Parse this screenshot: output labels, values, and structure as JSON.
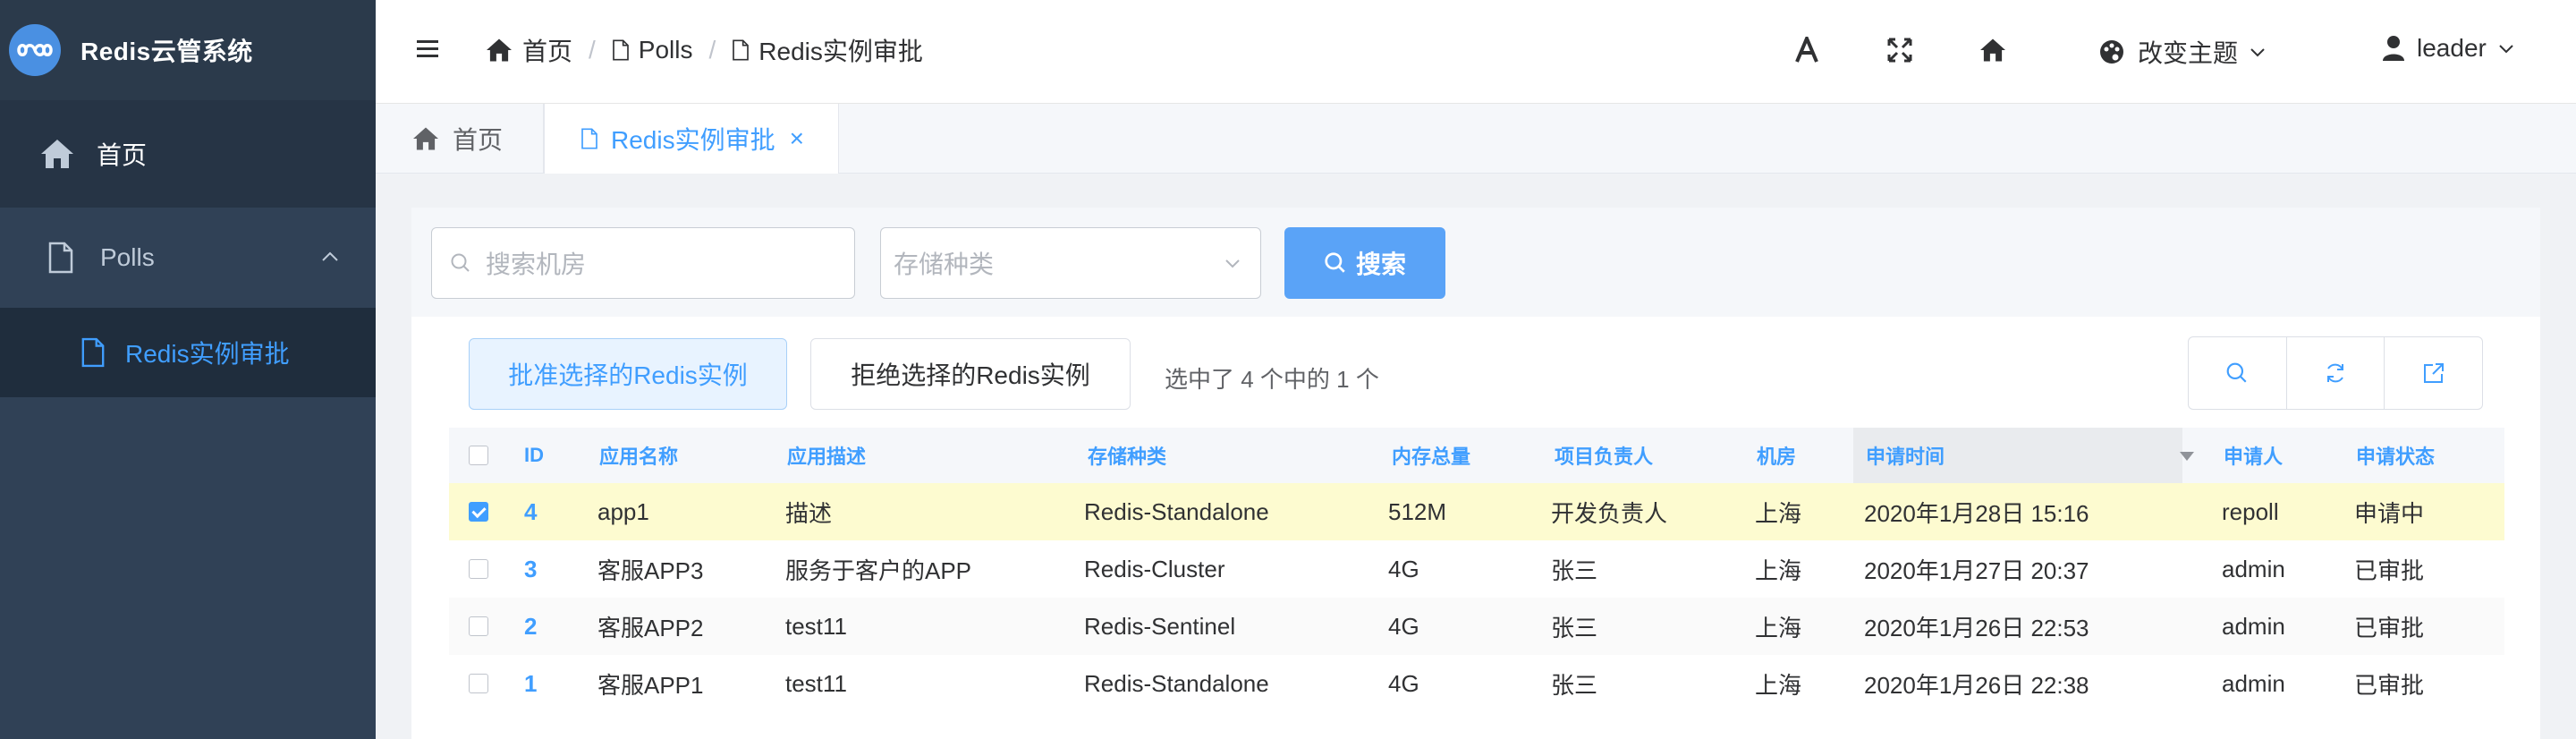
{
  "app": {
    "title": "Redis云管系统"
  },
  "sidebar": {
    "items": [
      {
        "label": "首页"
      },
      {
        "label": "Polls"
      },
      {
        "label": "Redis实例审批"
      }
    ]
  },
  "header": {
    "breadcrumb": [
      "首页",
      "Polls",
      "Redis实例审批"
    ],
    "theme_label": "改变主题",
    "user_label": "leader"
  },
  "tags": [
    {
      "label": "首页"
    },
    {
      "label": "Redis实例审批"
    }
  ],
  "search": {
    "room_placeholder": "搜索机房",
    "type_placeholder": "存储种类",
    "button_label": "搜索"
  },
  "actions": {
    "approve_label": "批准选择的Redis实例",
    "reject_label": "拒绝选择的Redis实例",
    "selection_info": "选中了 4 个中的 1 个"
  },
  "table": {
    "columns": [
      "ID",
      "应用名称",
      "应用描述",
      "存储种类",
      "内存总量",
      "项目负责人",
      "机房",
      "申请时间",
      "申请人",
      "申请状态"
    ],
    "rows": [
      {
        "checked": true,
        "id": "4",
        "name": "app1",
        "desc": "描述",
        "type": "Redis-Standalone",
        "mem": "512M",
        "owner": "开发负责人",
        "room": "上海",
        "time": "2020年1月28日 15:16",
        "applicant": "repoll",
        "status": "申请中"
      },
      {
        "checked": false,
        "id": "3",
        "name": "客服APP3",
        "desc": "服务于客户的APP",
        "type": "Redis-Cluster",
        "mem": "4G",
        "owner": "张三",
        "room": "上海",
        "time": "2020年1月27日 20:37",
        "applicant": "admin",
        "status": "已审批"
      },
      {
        "checked": false,
        "id": "2",
        "name": "客服APP2",
        "desc": "test11",
        "type": "Redis-Sentinel",
        "mem": "4G",
        "owner": "张三",
        "room": "上海",
        "time": "2020年1月26日 22:53",
        "applicant": "admin",
        "status": "已审批"
      },
      {
        "checked": false,
        "id": "1",
        "name": "客服APP1",
        "desc": "test11",
        "type": "Redis-Standalone",
        "mem": "4G",
        "owner": "张三",
        "room": "上海",
        "time": "2020年1月26日 22:38",
        "applicant": "admin",
        "status": "已审批"
      }
    ]
  },
  "colors": {
    "accent": "#409eff",
    "sidebar": "#304156",
    "selected_row": "#fdfbd0"
  }
}
